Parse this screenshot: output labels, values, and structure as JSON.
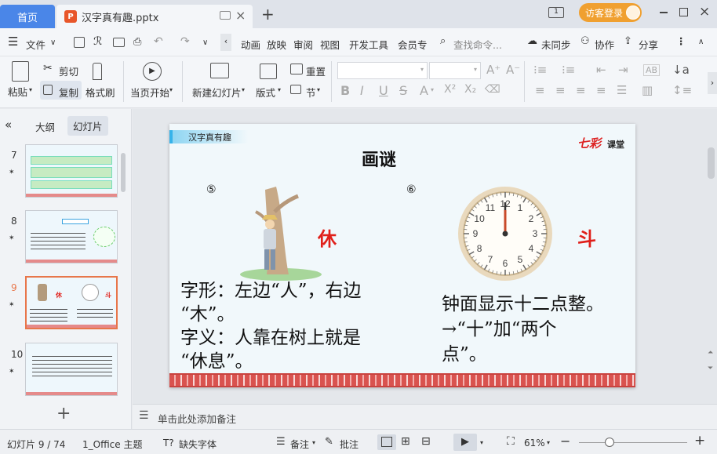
{
  "titlebar": {
    "home_tab": "首页",
    "doc_tab": "汉字真有趣.pptx",
    "ppt_icon": "P",
    "login_label": "访客登录",
    "page_indicator": "1"
  },
  "menubar": {
    "file": "文件",
    "items": [
      "动画",
      "放映",
      "审阅",
      "视图",
      "开发工具",
      "会员专"
    ],
    "search_placeholder": "查找命令...",
    "sync": "未同步",
    "collab": "协作",
    "share": "分享"
  },
  "ribbon": {
    "paste": "粘贴",
    "cut": "剪切",
    "copy": "复制",
    "format_painter": "格式刷",
    "from_current": "当页开始",
    "new_slide": "新建幻灯片",
    "layout": "版式",
    "reset": "重置",
    "section": "节"
  },
  "left_panel": {
    "tab_outline": "大纲",
    "tab_slides": "幻灯片",
    "thumbnails": [
      {
        "num": "7"
      },
      {
        "num": "8"
      },
      {
        "num": "9"
      },
      {
        "num": "10"
      }
    ]
  },
  "slide": {
    "header_tag": "汉字真有趣",
    "brand_logo": "七彩",
    "brand_text": "课堂",
    "title": "画谜",
    "num5": "⑤",
    "num6": "⑥",
    "char1": "休",
    "char2": "斗",
    "clock_numbers": [
      "12",
      "1",
      "2",
      "3",
      "4",
      "5",
      "6",
      "7",
      "8",
      "9",
      "10",
      "11"
    ],
    "left_text": [
      "字形：左边“人”，右边",
      "“木”。",
      "字义：人靠在树上就是",
      "“休息”。"
    ],
    "right_text": [
      "钟面显示十二点整。",
      "→“十”加“两个",
      "点”。"
    ]
  },
  "notes_placeholder": "单击此处添加备注",
  "status": {
    "slide_count": "幻灯片 9 / 74",
    "theme": "1_Office 主题",
    "missing_font": "缺失字体",
    "notes": "备注",
    "comments": "批注",
    "zoom": "61%"
  },
  "colors": {
    "accent_blue": "#4a86e8",
    "char_red": "#e0201a",
    "selected_border": "#e8764a",
    "login_orange": "#f0a030"
  }
}
